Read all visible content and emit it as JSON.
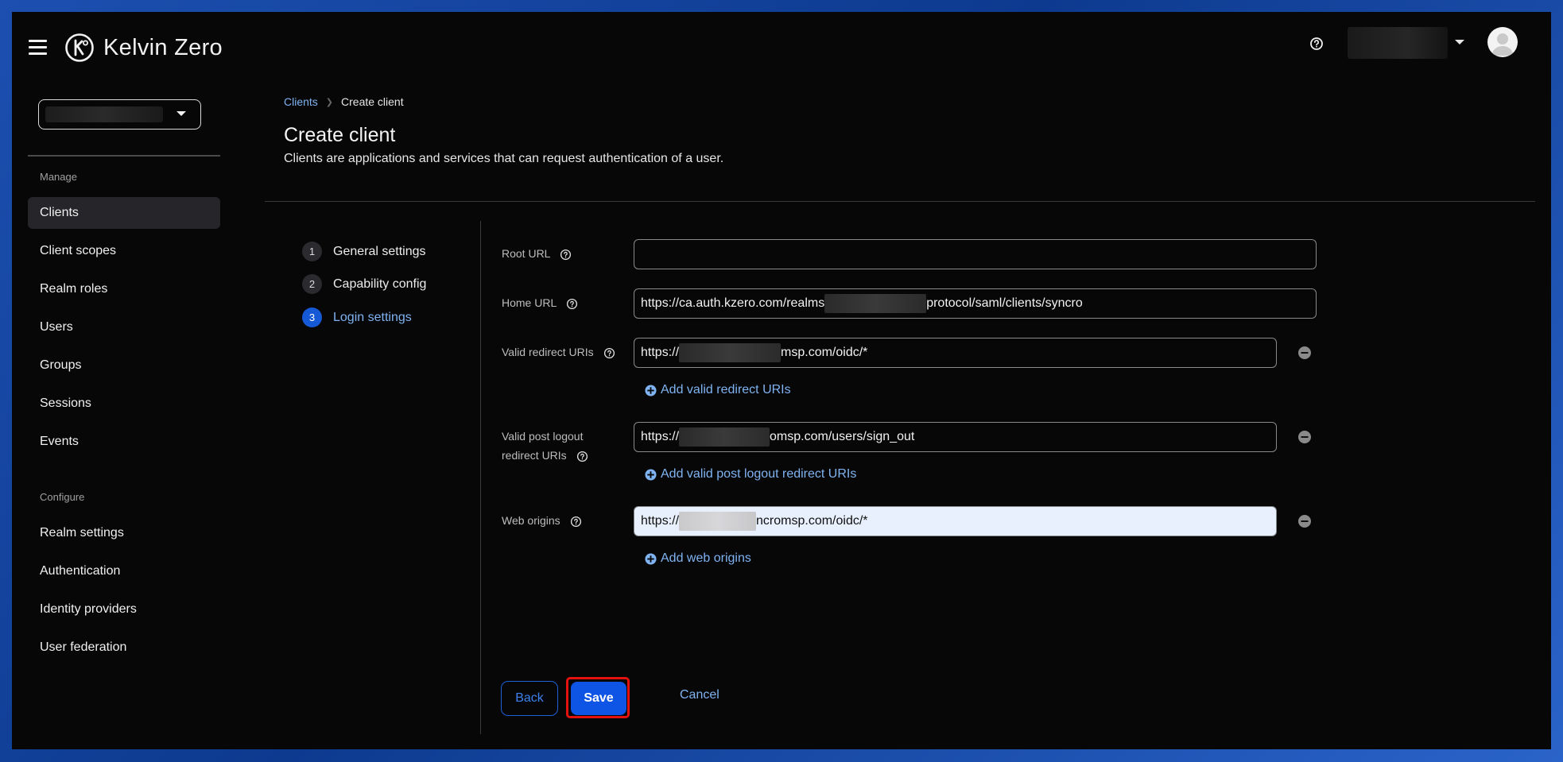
{
  "header": {
    "app_name": "Kelvin Zero",
    "icons": {
      "menu": "hamburger-menu-icon",
      "help": "help-circle-icon",
      "avatar": "user-avatar-icon",
      "logo": "kelvin-zero-logo"
    }
  },
  "sidebar": {
    "realm_select_value": "",
    "sections": {
      "manage": "Manage",
      "configure": "Configure"
    },
    "manage_items": [
      {
        "label": "Clients",
        "active": true
      },
      {
        "label": "Client scopes"
      },
      {
        "label": "Realm roles"
      },
      {
        "label": "Users"
      },
      {
        "label": "Groups"
      },
      {
        "label": "Sessions"
      },
      {
        "label": "Events"
      }
    ],
    "configure_items": [
      {
        "label": "Realm settings"
      },
      {
        "label": "Authentication"
      },
      {
        "label": "Identity providers"
      },
      {
        "label": "User federation"
      }
    ]
  },
  "breadcrumb": {
    "parent": "Clients",
    "current": "Create client"
  },
  "page": {
    "title": "Create client",
    "description": "Clients are applications and services that can request authentication of a user."
  },
  "wizard": {
    "steps": [
      {
        "num": "1",
        "label": "General settings"
      },
      {
        "num": "2",
        "label": "Capability config"
      },
      {
        "num": "3",
        "label": "Login settings",
        "current": true
      }
    ]
  },
  "form": {
    "root_url": {
      "label": "Root URL",
      "value": ""
    },
    "home_url": {
      "label": "Home URL",
      "value_prefix": "https://ca.auth.kzero.com/realms",
      "value_suffix": "protocol/saml/clients/syncro"
    },
    "valid_redirect": {
      "label": "Valid redirect URIs",
      "value_prefix": "https://",
      "value_suffix": "msp.com/oidc/*",
      "add_label": "Add valid redirect URIs"
    },
    "post_logout": {
      "label_line1": "Valid post logout",
      "label_line2": "redirect URIs",
      "value_prefix": "https://",
      "value_suffix": "omsp.com/users/sign_out",
      "add_label": "Add valid post logout redirect URIs"
    },
    "web_origins": {
      "label": "Web origins",
      "value_prefix": "https://",
      "value_suffix": "ncromsp.com/oidc/*",
      "add_label": "Add web origins"
    }
  },
  "actions": {
    "back": "Back",
    "save": "Save",
    "cancel": "Cancel"
  },
  "colors": {
    "accent": "#0e55e6",
    "link": "#7fb3f2",
    "highlight": "#e3120f",
    "background": "#070707"
  }
}
